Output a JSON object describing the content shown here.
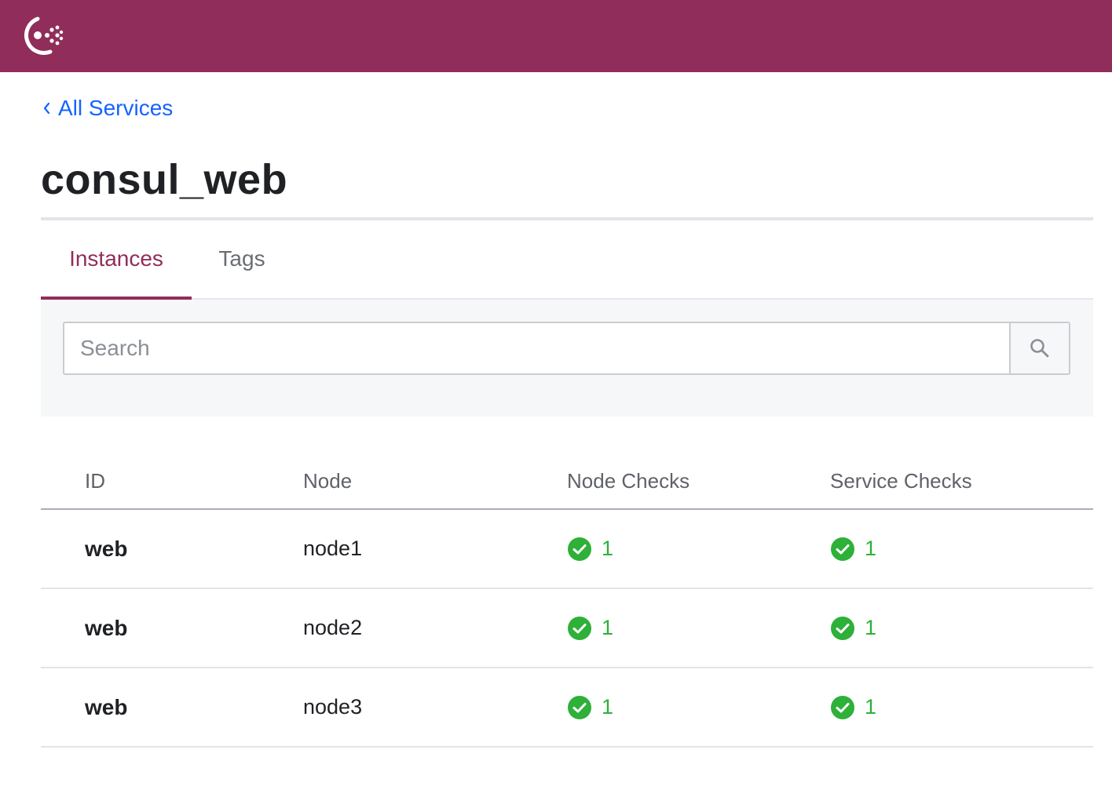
{
  "colors": {
    "brand": "#912d5a",
    "link": "#1563ff",
    "passing": "#2eb039"
  },
  "header": {
    "logo_icon": "consul-logo-icon"
  },
  "breadcrumb": {
    "label": "All Services",
    "icon": "chevron-left-icon"
  },
  "page": {
    "title": "consul_web"
  },
  "tabs": [
    {
      "label": "Instances",
      "active": true
    },
    {
      "label": "Tags",
      "active": false
    }
  ],
  "search": {
    "placeholder": "Search",
    "value": "",
    "icon": "search-icon"
  },
  "table": {
    "columns": [
      "ID",
      "Node",
      "Node Checks",
      "Service Checks"
    ],
    "rows": [
      {
        "id": "web",
        "node": "node1",
        "node_checks": "1",
        "service_checks": "1",
        "status_icon": "check-circle-icon"
      },
      {
        "id": "web",
        "node": "node2",
        "node_checks": "1",
        "service_checks": "1",
        "status_icon": "check-circle-icon"
      },
      {
        "id": "web",
        "node": "node3",
        "node_checks": "1",
        "service_checks": "1",
        "status_icon": "check-circle-icon"
      }
    ]
  }
}
